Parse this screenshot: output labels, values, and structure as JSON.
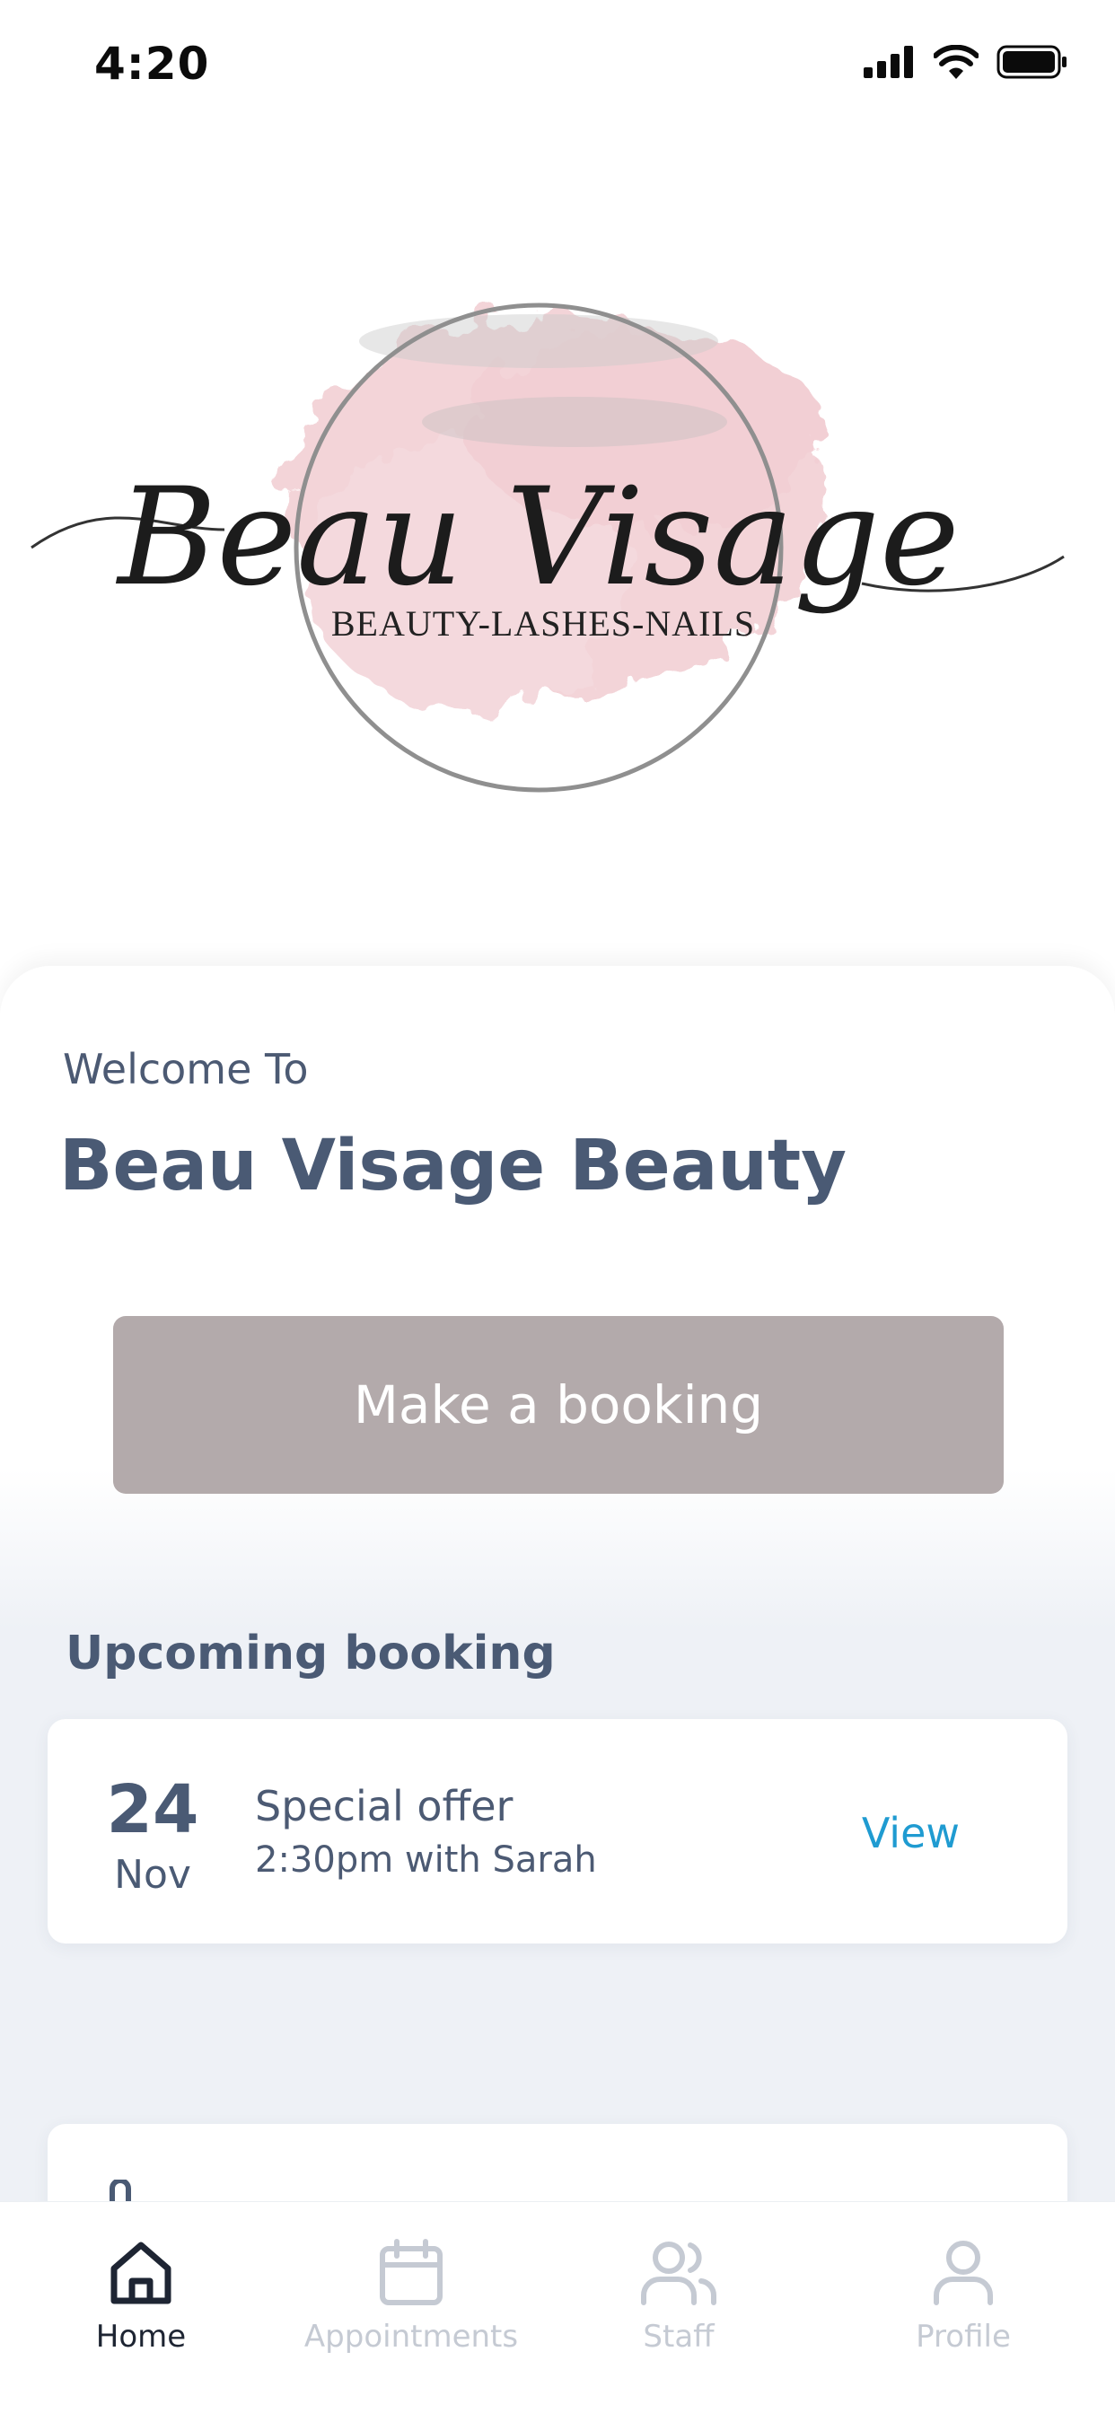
{
  "status_bar": {
    "time": "4:20",
    "icons": [
      "signal-icon",
      "wifi-icon",
      "battery-icon"
    ]
  },
  "logo": {
    "script_text": "Beau Visage",
    "tagline": "BEAUTY-LASHES-NAILS",
    "colors": {
      "wash": "#f0c9cf",
      "ring": "#8c8c8c",
      "ink": "#1c1c1c"
    }
  },
  "welcome": {
    "label": "Welcome To",
    "business_name": "Beau Visage Beauty"
  },
  "booking_button": {
    "label": "Make a booking",
    "color": "#b3aaab"
  },
  "upcoming": {
    "title": "Upcoming booking",
    "booking": {
      "day": "24",
      "month": "Nov",
      "service": "Special offer",
      "detail": "2:30pm with Sarah",
      "action": "View"
    }
  },
  "bottom_nav": {
    "items": [
      {
        "label": "Home",
        "icon": "home-icon",
        "active": true
      },
      {
        "label": "Appointments",
        "icon": "calendar-icon",
        "active": false
      },
      {
        "label": "Staff",
        "icon": "users-icon",
        "active": false
      },
      {
        "label": "Profile",
        "icon": "user-icon",
        "active": false
      }
    ]
  },
  "colors": {
    "primary_text": "#4a5a74",
    "link": "#1f9bd1",
    "nav_active": "#1e2533",
    "nav_inactive": "#c5cad3",
    "background_tint": "#eef1f6"
  }
}
